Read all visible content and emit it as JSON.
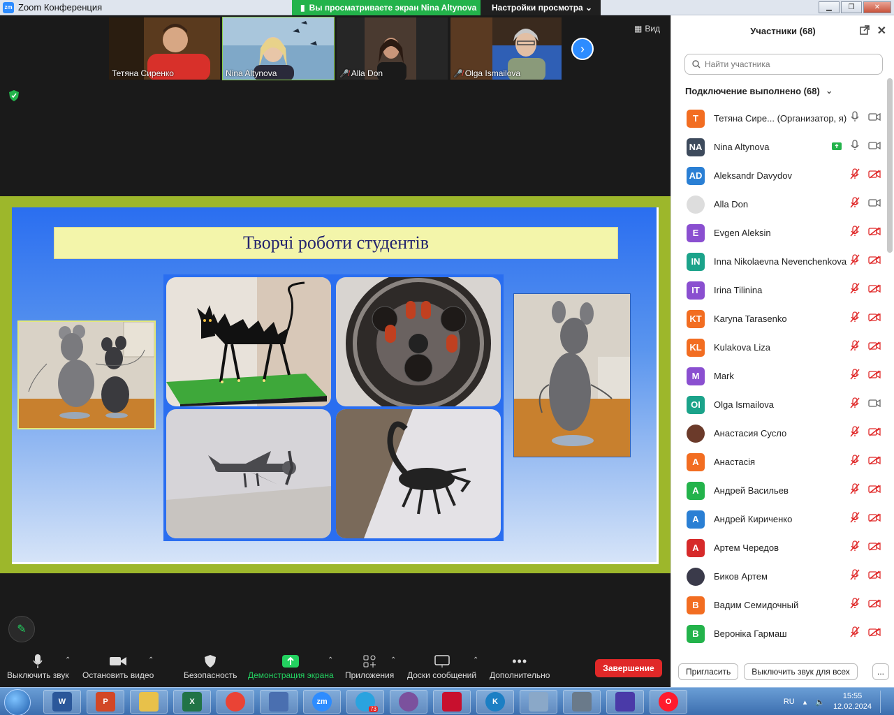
{
  "window": {
    "app_title": "Zoom Конференция",
    "share_banner": "Вы просматриваете экран Nina Altynova",
    "view_options": "Настройки просмотра"
  },
  "video": {
    "view_label": "Вид",
    "thumbnails": [
      {
        "name": "Тетяна Сиренко",
        "muted": false
      },
      {
        "name": "Nina Altynova",
        "muted": false
      },
      {
        "name": "Alla Don",
        "muted": true
      },
      {
        "name": "Olga Ismailova",
        "muted": true
      }
    ]
  },
  "slide": {
    "title": "Творчі роботи студентів"
  },
  "toolbar": {
    "mute": "Выключить звук",
    "stop_video": "Остановить видео",
    "security": "Безопасность",
    "share": "Демонстрация экрана",
    "apps": "Приложения",
    "boards": "Доски сообщений",
    "more": "Дополнительно",
    "end": "Завершение"
  },
  "panel": {
    "title": "Участники (68)",
    "search_placeholder": "Найти участника",
    "section": "Подключение выполнено (68)",
    "participants": [
      {
        "initials": "Т",
        "name": "Тетяна Сире...  (Организатор, я)",
        "color": "#f26d21",
        "mic": "on",
        "cam": "off"
      },
      {
        "initials": "NA",
        "name": "Nina Altynova",
        "color": "#3d4a5c",
        "mic": "on",
        "cam": "off",
        "sharing": true
      },
      {
        "initials": "AD",
        "name": "Aleksandr Davydov",
        "color": "#2a7fd4",
        "mic": "muted",
        "cam": "muted"
      },
      {
        "initials": "",
        "name": "Alla Don",
        "color": "#dddddd",
        "mic": "muted",
        "cam": "off",
        "photo": true
      },
      {
        "initials": "E",
        "name": "Evgen Aleksin",
        "color": "#8a4fd0",
        "mic": "muted",
        "cam": "muted"
      },
      {
        "initials": "IN",
        "name": "Inna Nikolaevna Nevenchenkova",
        "color": "#1ba38a",
        "mic": "muted",
        "cam": "muted"
      },
      {
        "initials": "IT",
        "name": "Irina Tilinina",
        "color": "#8a4fd0",
        "mic": "muted",
        "cam": "muted"
      },
      {
        "initials": "KT",
        "name": "Karyna Tarasenko",
        "color": "#f26d21",
        "mic": "muted",
        "cam": "muted"
      },
      {
        "initials": "KL",
        "name": "Kulakova Liza",
        "color": "#f26d21",
        "mic": "muted",
        "cam": "muted"
      },
      {
        "initials": "M",
        "name": "Mark",
        "color": "#8a4fd0",
        "mic": "muted",
        "cam": "muted"
      },
      {
        "initials": "OI",
        "name": "Olga Ismailova",
        "color": "#1ba38a",
        "mic": "muted",
        "cam": "off"
      },
      {
        "initials": "",
        "name": "Анастасия Сусло",
        "color": "#6b3a2a",
        "mic": "muted",
        "cam": "muted",
        "photo": true
      },
      {
        "initials": "А",
        "name": "Анастасія",
        "color": "#f26d21",
        "mic": "muted",
        "cam": "muted"
      },
      {
        "initials": "А",
        "name": "Андрей Васильев",
        "color": "#23b34b",
        "mic": "muted",
        "cam": "muted"
      },
      {
        "initials": "А",
        "name": "Андрей Кириченко",
        "color": "#2a7fd4",
        "mic": "muted",
        "cam": "muted"
      },
      {
        "initials": "А",
        "name": "Артем Чередов",
        "color": "#d62a2a",
        "mic": "muted",
        "cam": "muted"
      },
      {
        "initials": "",
        "name": "Биков Артем",
        "color": "#3a3a4a",
        "mic": "muted",
        "cam": "muted",
        "photo": true
      },
      {
        "initials": "В",
        "name": "Вадим Семидочный",
        "color": "#f26d21",
        "mic": "muted",
        "cam": "muted"
      },
      {
        "initials": "В",
        "name": "Вероніка Гармаш",
        "color": "#23b34b",
        "mic": "muted",
        "cam": "muted"
      }
    ],
    "invite": "Пригласить",
    "mute_all": "Выключить звук для всех",
    "more": "..."
  },
  "taskbar": {
    "lang": "RU",
    "time": "15:55",
    "date": "12.02.2024",
    "telegram_badge": "73",
    "apps": [
      {
        "name": "word-icon",
        "label": "W",
        "color": "#2b579a"
      },
      {
        "name": "presentation-icon",
        "label": "P",
        "color": "#d24726"
      },
      {
        "name": "folder-icon",
        "label": "",
        "color": "#e8c14a"
      },
      {
        "name": "excel-icon",
        "label": "X",
        "color": "#217346"
      },
      {
        "name": "chrome-icon",
        "label": "",
        "color": "#ea4335"
      },
      {
        "name": "paint-icon",
        "label": "",
        "color": "#4a6fb0"
      },
      {
        "name": "zoom-icon",
        "label": "zm",
        "color": "#2d8cff"
      },
      {
        "name": "telegram-icon",
        "label": "",
        "color": "#2aa3df"
      },
      {
        "name": "viber-icon",
        "label": "",
        "color": "#7b519d"
      },
      {
        "name": "red-app-icon",
        "label": "",
        "color": "#c8102e"
      },
      {
        "name": "k-app-icon",
        "label": "K",
        "color": "#1c7fc4"
      },
      {
        "name": "calculator-icon",
        "label": "",
        "color": "#8aa8c8"
      },
      {
        "name": "scanner-icon",
        "label": "",
        "color": "#6a7a8a"
      },
      {
        "name": "notes-app-icon",
        "label": "",
        "color": "#4a3aa8"
      },
      {
        "name": "opera-icon",
        "label": "O",
        "color": "#ff1b2d"
      }
    ]
  }
}
